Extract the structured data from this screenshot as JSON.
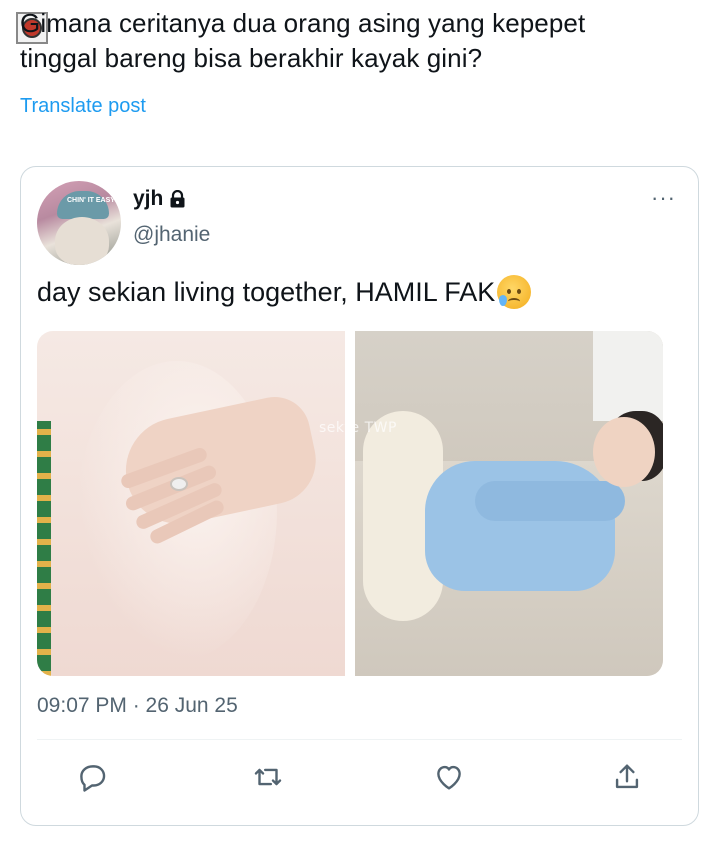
{
  "post": {
    "text_line1": "Gimana ceritanya dua orang asing yang kepepet",
    "text_line2": "tinggal bareng bisa berakhir kayak gini?",
    "translate_label": "Translate post"
  },
  "quoted": {
    "display_name": "yjh",
    "handle": "@jhanie",
    "verified_lock": true,
    "avatar_hat_text": "CHIN' IT EASY",
    "more_label": "···",
    "text": "day sekian living together, HAMIL FAK",
    "emoji": "sad-but-relieved-face",
    "watermark": "sekte TWP",
    "timestamp": "09:07 PM · 26 Jun 25"
  },
  "actions": [
    {
      "icon": "reply-icon"
    },
    {
      "icon": "retweet-icon"
    },
    {
      "icon": "like-icon"
    },
    {
      "icon": "share-icon"
    }
  ],
  "colors": {
    "link": "#1d9bf0",
    "secondary": "#536471",
    "text": "#0f1419",
    "border": "#cfd9de"
  }
}
